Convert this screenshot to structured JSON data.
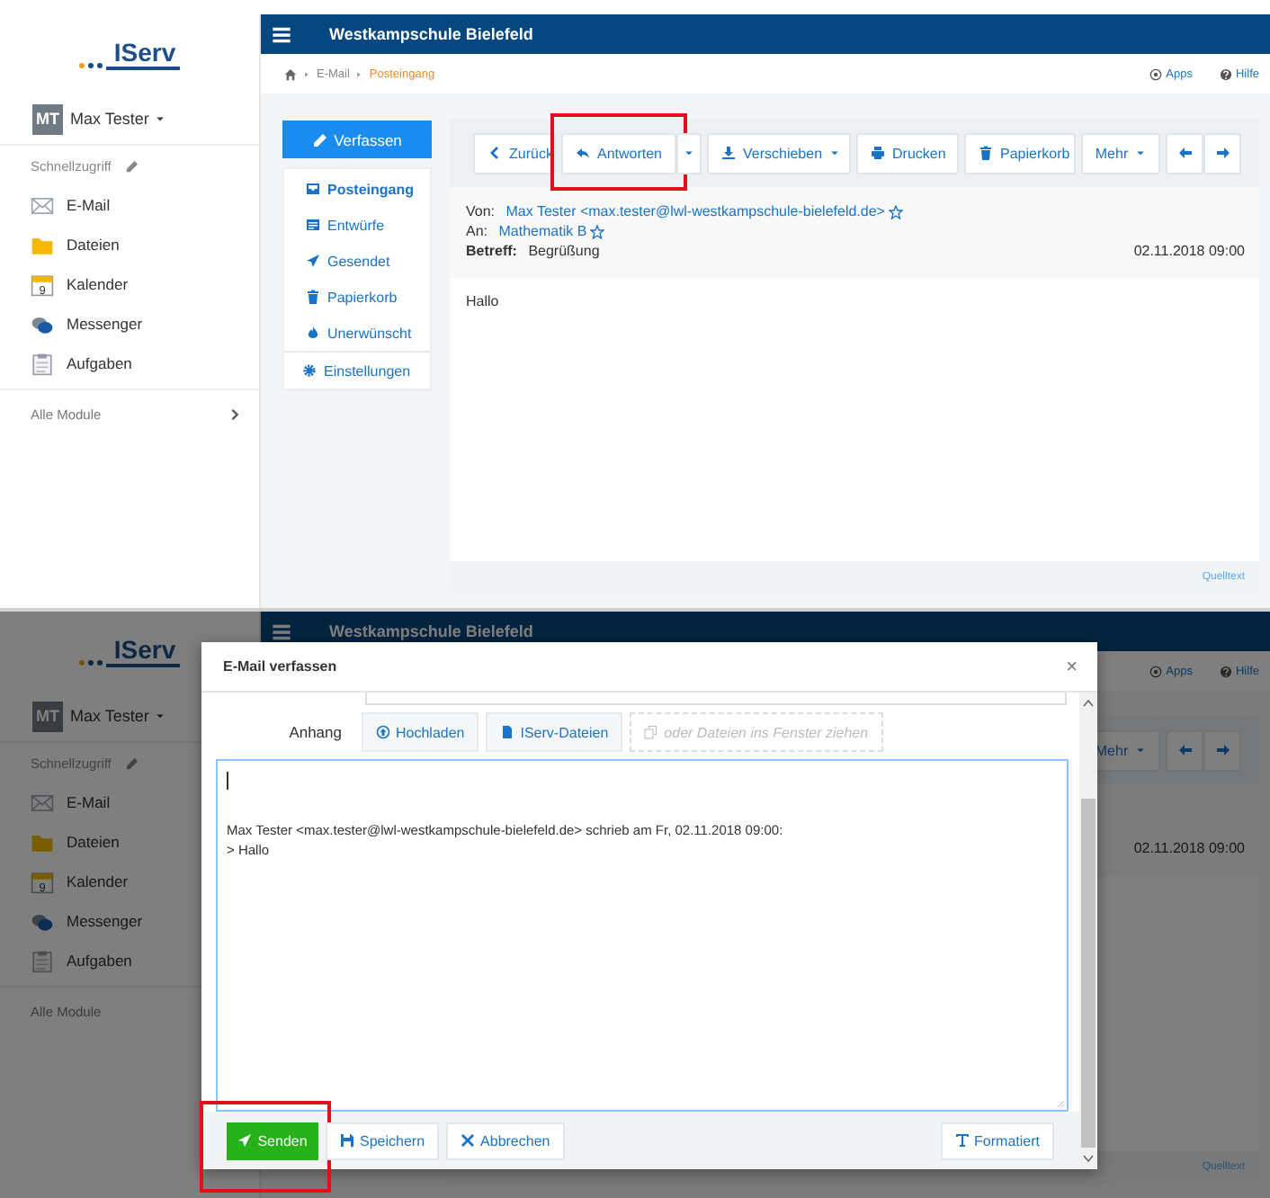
{
  "top_screen": {
    "logo": "IServ",
    "user": {
      "initials": "MT",
      "name": "Max Tester"
    },
    "quick_access": "Schnellzugriff",
    "modules": [
      {
        "label": "E-Mail",
        "kind": "mail"
      },
      {
        "label": "Dateien",
        "kind": "files"
      },
      {
        "label": "Kalender",
        "kind": "calendar",
        "day": "9"
      },
      {
        "label": "Messenger",
        "kind": "messenger"
      },
      {
        "label": "Aufgaben",
        "kind": "tasks"
      }
    ],
    "all_modules": "Alle Module",
    "school": "Westkampschule Bielefeld",
    "breadcrumb": [
      {
        "label": "E-Mail",
        "selected": false
      },
      {
        "label": "Posteingang",
        "selected": true
      }
    ],
    "header_links": [
      {
        "label": "Apps",
        "kind": "apps"
      },
      {
        "label": "Hilfe",
        "kind": "help"
      }
    ],
    "compose_button": "Verfassen",
    "folders": [
      {
        "label": "Posteingang",
        "kind": "inbox",
        "selected": true
      },
      {
        "label": "Entwürfe",
        "kind": "drafts",
        "selected": false
      },
      {
        "label": "Gesendet",
        "kind": "sent",
        "selected": false
      },
      {
        "label": "Papierkorb",
        "kind": "trash",
        "selected": false
      },
      {
        "label": "Unerwünscht",
        "kind": "spam",
        "selected": false
      }
    ],
    "settings": "Einstellungen",
    "toolbar": [
      {
        "label": "Zurück",
        "kind": "back",
        "highlighted": false
      },
      {
        "label": "Antworten",
        "kind": "reply",
        "highlighted": true
      },
      {
        "kind": "split",
        "highlighted": false
      },
      {
        "label": "Verschieben",
        "kind": "move",
        "highlighted": false
      },
      {
        "label": "Drucken",
        "kind": "print",
        "highlighted": false
      },
      {
        "label": "Papierkorb",
        "kind": "trash",
        "highlighted": false
      },
      {
        "label": "Mehr",
        "kind": "more",
        "highlighted": false
      },
      {
        "kind": "prev",
        "highlighted": false
      },
      {
        "kind": "next",
        "highlighted": false
      }
    ],
    "mail": {
      "from_label": "Von:",
      "from": "Max Tester <max.tester@lwl-westkampschule-bielefeld.de>",
      "to_label": "An:",
      "to": "Mathematik B",
      "subject_label": "Betreff:",
      "subject": "Begrüßung",
      "date": "02.11.2018 09:00",
      "body": "Hallo",
      "source_link": "Quelltext"
    }
  },
  "bottom_screen": {
    "logo": "IServ",
    "user": {
      "initials": "MT",
      "name": "Max Tester"
    },
    "quick_access": "Schnellzugriff",
    "modules": [
      {
        "label": "E-Mail",
        "kind": "mail"
      },
      {
        "label": "Dateien",
        "kind": "files"
      },
      {
        "label": "Kalender",
        "kind": "calendar",
        "day": "9"
      },
      {
        "label": "Messenger",
        "kind": "messenger"
      },
      {
        "label": "Aufgaben",
        "kind": "tasks"
      }
    ],
    "all_modules": "Alle Module",
    "school": "Westkampschule Bielefeld",
    "header_links": [
      {
        "label": "Apps",
        "kind": "apps"
      },
      {
        "label": "Hilfe",
        "kind": "help"
      }
    ],
    "toolbar": [
      {
        "label": "Mehr",
        "kind": "more",
        "highlighted": false
      },
      {
        "kind": "prev",
        "highlighted": false
      },
      {
        "kind": "next",
        "highlighted": false
      }
    ],
    "mail": {
      "date": "02.11.2018 09:00",
      "source_link": "Quelltext"
    },
    "dialog": {
      "title": "E-Mail verfassen",
      "close": "×",
      "attachment_label": "Anhang",
      "attach_buttons": [
        {
          "label": "Hochladen",
          "kind": "upload"
        },
        {
          "label": "IServ-Dateien",
          "kind": "files"
        }
      ],
      "drop_hint": "oder Dateien ins Fenster ziehen",
      "message": "\n\n\nMax Tester <max.tester@lwl-westkampschule-bielefeld.de> schrieb am Fr, 02.11.2018 09:00:\n> Hallo",
      "footer_buttons": [
        {
          "label": "Senden",
          "kind": "send",
          "highlighted": true
        },
        {
          "label": "Speichern",
          "kind": "save",
          "highlighted": false
        },
        {
          "label": "Abbrechen",
          "kind": "cancel",
          "highlighted": false
        }
      ],
      "format_button": "Formatiert"
    }
  }
}
